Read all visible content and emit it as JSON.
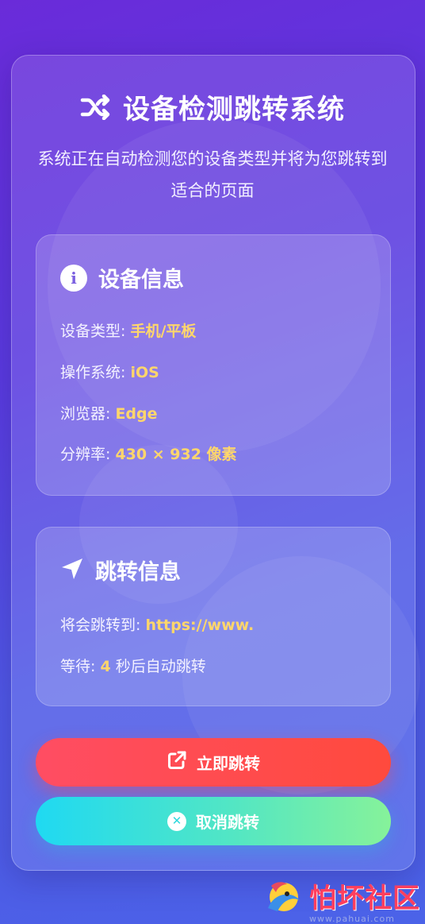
{
  "header": {
    "title": "设备检测跳转系统",
    "subtitle": "系统正在自动检测您的设备类型并将为您跳转到适合的页面",
    "icon": "shuffle-icon"
  },
  "device_panel": {
    "title": "设备信息",
    "icon": "info-circle-icon",
    "rows": [
      {
        "label": "设备类型: ",
        "value": "手机/平板"
      },
      {
        "label": "操作系统: ",
        "value": "iOS"
      },
      {
        "label": "浏览器: ",
        "value": "Edge"
      },
      {
        "label": "分辨率: ",
        "value": "430 × 932 像素"
      }
    ]
  },
  "redirect_panel": {
    "title": "跳转信息",
    "icon": "location-arrow-icon",
    "target_label": "将会跳转到: ",
    "target_value": "https://www.",
    "wait_label": "等待: ",
    "wait_seconds": "4",
    "wait_suffix": " 秒后自动跳转"
  },
  "buttons": {
    "go_label": "立即跳转",
    "go_icon": "external-link-icon",
    "cancel_label": "取消跳转",
    "cancel_icon": "close-circle-icon"
  },
  "watermark": {
    "text": "怕坏社区",
    "url": "www.pahuai.com"
  },
  "colors": {
    "accent_value": "#ffd66b",
    "go_button": "#ff4a55",
    "cancel_button": "#3ddfd8"
  }
}
